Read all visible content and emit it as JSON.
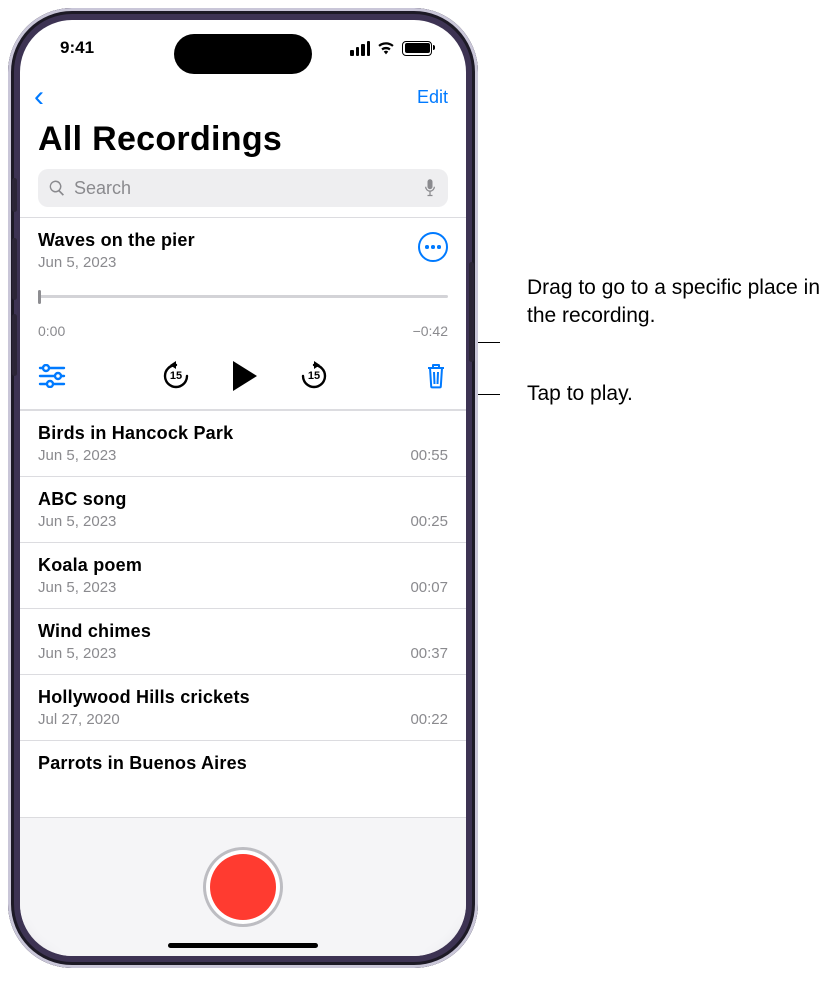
{
  "status": {
    "time": "9:41"
  },
  "nav": {
    "edit": "Edit"
  },
  "title": "All Recordings",
  "search": {
    "placeholder": "Search"
  },
  "expanded": {
    "title": "Waves on the pier",
    "date": "Jun 5, 2023",
    "elapsed": "0:00",
    "remaining": "−0:42",
    "skip_amount": "15"
  },
  "recordings": [
    {
      "title": "Birds in Hancock Park",
      "date": "Jun 5, 2023",
      "dur": "00:55"
    },
    {
      "title": "ABC song",
      "date": "Jun 5, 2023",
      "dur": "00:25"
    },
    {
      "title": "Koala poem",
      "date": "Jun 5, 2023",
      "dur": "00:07"
    },
    {
      "title": "Wind chimes",
      "date": "Jun 5, 2023",
      "dur": "00:37"
    },
    {
      "title": "Hollywood Hills crickets",
      "date": "Jul 27, 2020",
      "dur": "00:22"
    },
    {
      "title": "Parrots in Buenos Aires",
      "date": "",
      "dur": ""
    }
  ],
  "callouts": {
    "scrubber": "Drag to go to a specific place in the recording.",
    "play": "Tap to play."
  }
}
